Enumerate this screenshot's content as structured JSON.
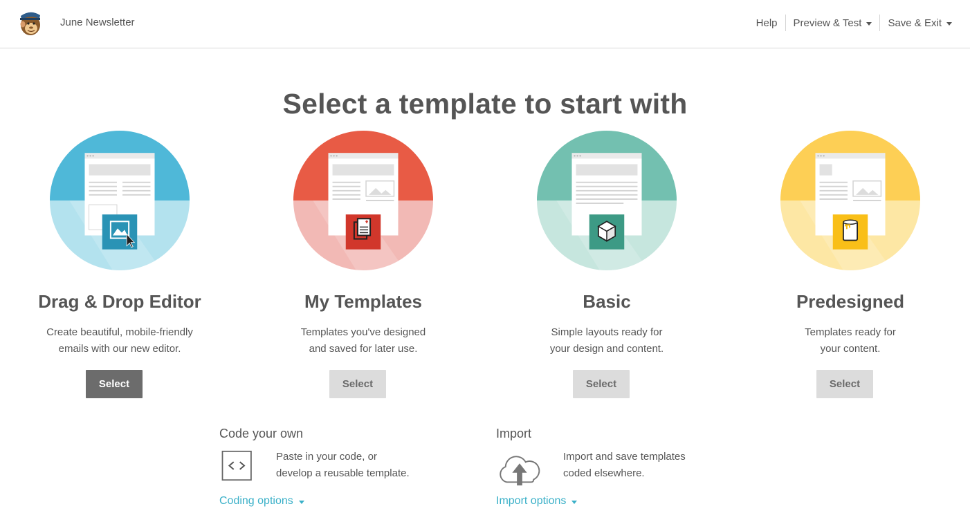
{
  "header": {
    "document_name": "June Newsletter",
    "nav": [
      {
        "label": "Help",
        "has_caret": false
      },
      {
        "label": "Preview & Test",
        "has_caret": true
      },
      {
        "label": "Save & Exit",
        "has_caret": true
      }
    ]
  },
  "main": {
    "title": "Select a template to start with",
    "cards": [
      {
        "id": "dnd",
        "title": "Drag & Drop Editor",
        "desc": [
          "Create beautiful, mobile-friendly",
          "emails with our new editor."
        ],
        "button": "Select",
        "button_style": "primary",
        "colors": {
          "top": "#4fb8d8",
          "bottom": "#b3e2ee",
          "badge": "#2a93b5"
        },
        "icon": "image-cursor-icon"
      },
      {
        "id": "my",
        "title": "My Templates",
        "desc": [
          "Templates you've designed",
          "and saved for later use."
        ],
        "button": "Select",
        "button_style": "secondary",
        "colors": {
          "top": "#e85b45",
          "bottom": "#f2b9b5",
          "badge": "#d1372b"
        },
        "icon": "documents-icon"
      },
      {
        "id": "basic",
        "title": "Basic",
        "desc": [
          "Simple layouts ready for",
          "your design and content."
        ],
        "button": "Select",
        "button_style": "secondary",
        "colors": {
          "top": "#73c0b0",
          "bottom": "#c6e6de",
          "badge": "#3d9a85"
        },
        "icon": "cube-icon"
      },
      {
        "id": "pre",
        "title": "Predesigned",
        "desc": [
          "Templates ready for",
          "your content."
        ],
        "button": "Select",
        "button_style": "secondary",
        "colors": {
          "top": "#fdcf55",
          "bottom": "#fde7a4",
          "badge": "#f9bf18"
        },
        "icon": "paint-can-icon"
      }
    ],
    "options": [
      {
        "id": "code",
        "title": "Code your own",
        "desc": [
          "Paste in your code, or",
          "develop a reusable template."
        ],
        "link": "Coding options",
        "icon": "code-icon"
      },
      {
        "id": "import",
        "title": "Import",
        "desc": [
          "Import and save templates",
          "coded elsewhere."
        ],
        "link": "Import options",
        "icon": "cloud-upload-icon"
      }
    ]
  },
  "colors": {
    "link": "#3ab0c8",
    "text": "#555555",
    "primary_button": "#6c6c6c",
    "secondary_button": "#dcdcdc"
  }
}
